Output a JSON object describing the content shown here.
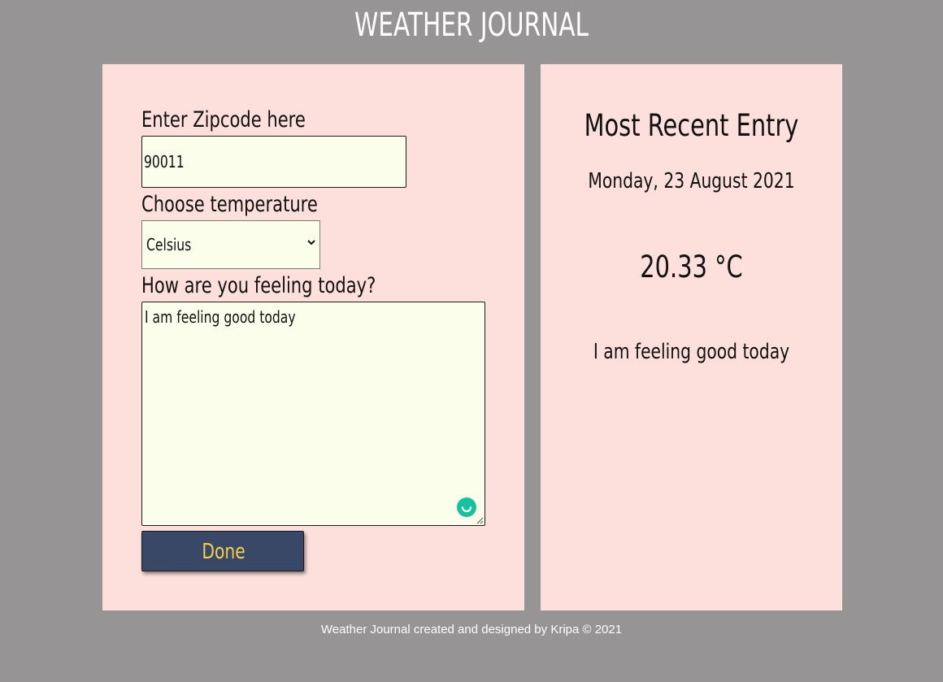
{
  "header": {
    "title": "WEATHER JOURNAL"
  },
  "form": {
    "zip_label": "Enter Zipcode here",
    "zip_value": "90011",
    "temp_label": "Choose temperature",
    "temp_selected": "Celsius",
    "feeling_label": "How are you feeling today?",
    "feeling_value": "I am feeling good today",
    "done_label": "Done"
  },
  "entry": {
    "title": "Most Recent Entry",
    "date": "Monday, 23 August 2021",
    "temperature": "20.33 °C",
    "feeling": "I am feeling good today"
  },
  "footer": {
    "text": "Weather Journal created and designed by Kripa © 2021"
  },
  "colors": {
    "background": "#979495",
    "panel": "#fde0db",
    "input_bg": "#fafeea",
    "button_bg": "#394867",
    "button_text": "#f2cf4a",
    "grammar_badge": "#15c39a"
  },
  "icons": {
    "select_arrow": "chevron-down-icon",
    "grammar_badge": "grammarly-icon",
    "resize": "resize-handle-icon"
  }
}
